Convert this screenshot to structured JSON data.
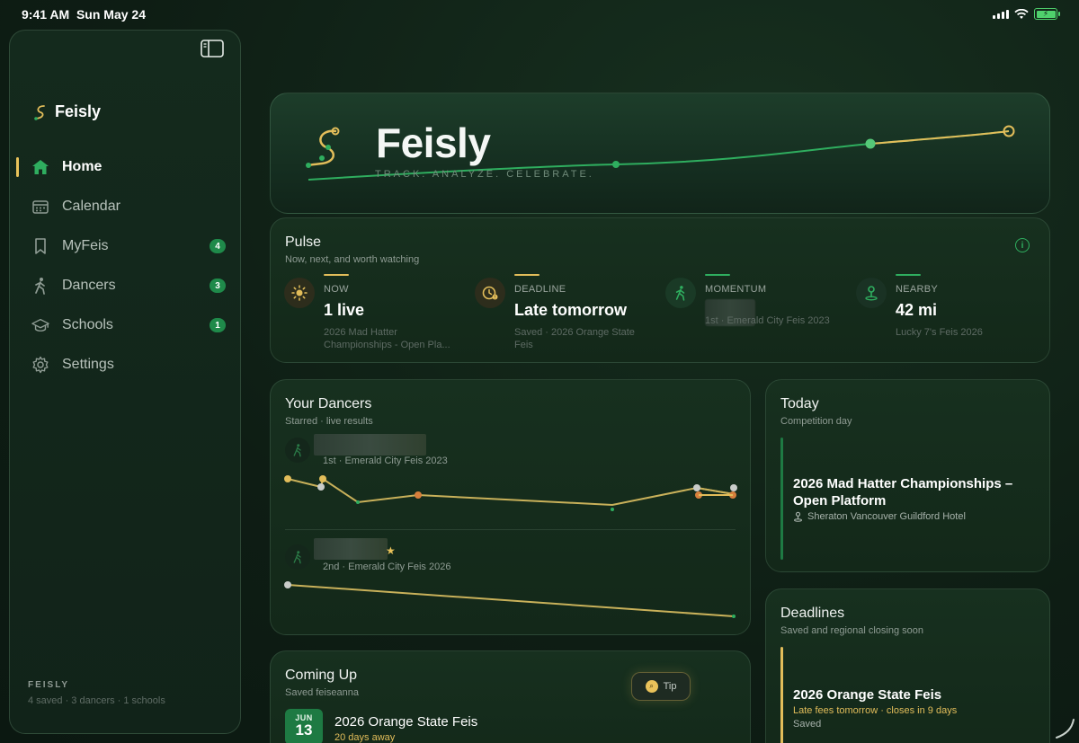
{
  "status_bar": {
    "time": "9:41 AM",
    "date": "Sun May 24"
  },
  "sidebar": {
    "brand": "Feisly",
    "items": [
      {
        "label": "Home",
        "icon": "home-icon",
        "active": true,
        "badge": ""
      },
      {
        "label": "Calendar",
        "icon": "calendar-icon",
        "active": false,
        "badge": ""
      },
      {
        "label": "MyFeis",
        "icon": "bookmark-icon",
        "active": false,
        "badge": "4"
      },
      {
        "label": "Dancers",
        "icon": "dancer-icon",
        "active": false,
        "badge": "3"
      },
      {
        "label": "Schools",
        "icon": "graduation-cap-icon",
        "active": false,
        "badge": "1"
      },
      {
        "label": "Settings",
        "icon": "gear-icon",
        "active": false,
        "badge": ""
      }
    ],
    "footer_title": "FEISLY",
    "footer_sub": "4 saved · 3 dancers · 1 schools"
  },
  "hero": {
    "title": "Feisly",
    "tagline": "TRACK. ANALYZE. CELEBRATE."
  },
  "pulse": {
    "title": "Pulse",
    "subtitle": "Now, next, and worth watching",
    "metrics": [
      {
        "label": "NOW",
        "value": "1 live",
        "note": "2026 Mad Hatter Championships - Open Pla...",
        "icon": "sun-icon",
        "accent": "#e2bd5a"
      },
      {
        "label": "DEADLINE",
        "value": "Late tomorrow",
        "note": "Saved · 2026 Orange State Feis",
        "icon": "clock-alert-icon",
        "accent": "#e2bd5a"
      },
      {
        "label": "MOMENTUM",
        "value": "",
        "note": "1st · Emerald City Feis 2023",
        "icon": "dancer-icon",
        "accent": "#2fae5f"
      },
      {
        "label": "NEARBY",
        "value": "42 mi",
        "note": "Lucky 7's Feis 2026",
        "icon": "pin-icon",
        "accent": "#2fae5f"
      }
    ]
  },
  "dancers": {
    "title": "Your Dancers",
    "subtitle": "Starred · live results",
    "list": [
      {
        "result": "1st · Emerald City Feis 2023",
        "starred": false
      },
      {
        "result": "2nd · Emerald City Feis 2026",
        "starred": true
      }
    ]
  },
  "today": {
    "title": "Today",
    "subtitle": "Competition day",
    "event": "2026 Mad Hatter Championships – Open Platform",
    "venue": "Sheraton Vancouver Guildford Hotel"
  },
  "deadlines": {
    "title": "Deadlines",
    "subtitle": "Saved and regional closing soon",
    "event": "2026 Orange State Feis",
    "note": "Late fees tomorrow · closes in 9 days",
    "status": "Saved"
  },
  "coming_up": {
    "title": "Coming Up",
    "subtitle": "Saved feiseanna",
    "tip_label": "Tip",
    "month": "JUN",
    "day": "13",
    "event": "2026 Orange State Feis",
    "away": "20 days away"
  },
  "colors": {
    "accent_gold": "#e2bd5a",
    "accent_green": "#2fae5f",
    "badge_green": "#1f8a4a"
  }
}
